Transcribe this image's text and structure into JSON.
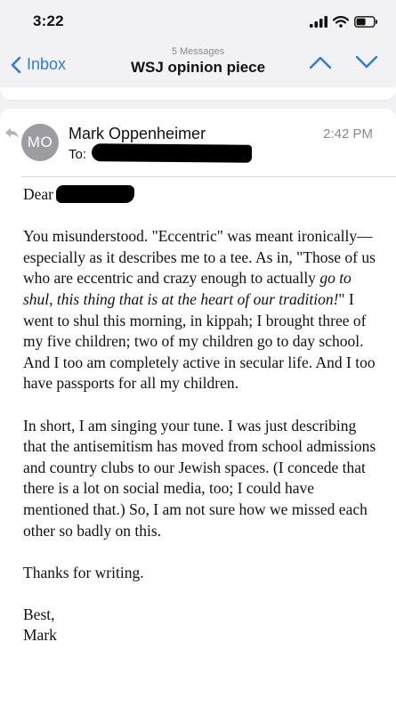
{
  "status_bar": {
    "time": "3:22"
  },
  "nav": {
    "back_label": "Inbox",
    "message_count": "5 Messages",
    "title": "WSJ opinion piece"
  },
  "message": {
    "avatar_initials": "MO",
    "sender": "Mark Oppenheimer",
    "to_label": "To:",
    "time": "2:42 PM",
    "greeting": "Dear",
    "para1_a": "You misunderstood. \"Eccentric\" was meant ironically—especially as it describes me to a tee. As in, \"Those of us who are eccentric and crazy enough to actually ",
    "para1_italic": "go to shul, this thing that is at the heart of our tradition!",
    "para1_b": "\" I went to shul this morning, in kippah; I brought three of my five children; two of my children go to day school. And I too am completely active in secular life. And I too have passports for all my children.",
    "para2": "In short, I am singing your tune. I was just describing that the antisemitism has moved from school admissions and country clubs to our Jewish spaces. (I concede that there is a lot on social media, too; I could have mentioned that.) So, I am not sure how we missed each other so badly on this.",
    "para3": "Thanks for writing.",
    "signoff": "Best,",
    "signature": "Mark"
  },
  "colors": {
    "accent": "#2f7ad6",
    "avatar": "#9c9ca2",
    "secondary_text": "#8a8a8e"
  }
}
